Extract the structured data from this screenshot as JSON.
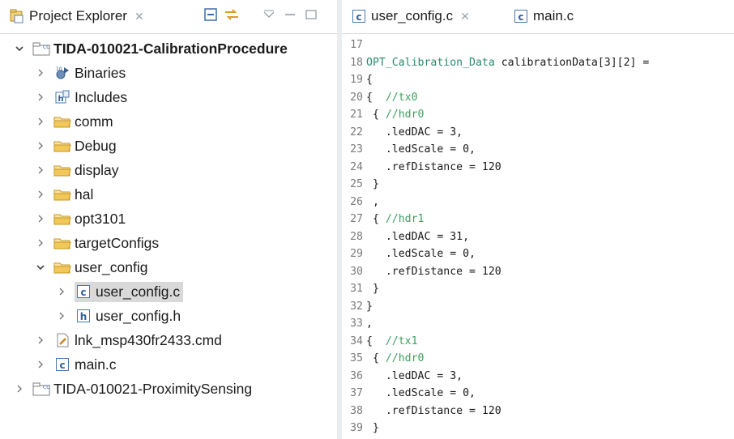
{
  "explorer": {
    "tab_label": "Project Explorer",
    "tree": [
      {
        "label": "TIDA-010021-CalibrationProcedure",
        "depth": 0,
        "expanded": true,
        "icon": "project-icon",
        "bold": true
      },
      {
        "label": "Binaries",
        "depth": 1,
        "expanded": false,
        "icon": "binaries-icon"
      },
      {
        "label": "Includes",
        "depth": 1,
        "expanded": false,
        "icon": "includes-icon"
      },
      {
        "label": "comm",
        "depth": 1,
        "expanded": false,
        "icon": "folder-icon"
      },
      {
        "label": "Debug",
        "depth": 1,
        "expanded": false,
        "icon": "folder-icon"
      },
      {
        "label": "display",
        "depth": 1,
        "expanded": false,
        "icon": "folder-icon"
      },
      {
        "label": "hal",
        "depth": 1,
        "expanded": false,
        "icon": "folder-icon"
      },
      {
        "label": "opt3101",
        "depth": 1,
        "expanded": false,
        "icon": "folder-icon"
      },
      {
        "label": "targetConfigs",
        "depth": 1,
        "expanded": false,
        "icon": "folder-icon"
      },
      {
        "label": "user_config",
        "depth": 1,
        "expanded": true,
        "icon": "folder-icon"
      },
      {
        "label": "user_config.c",
        "depth": 2,
        "expanded": false,
        "icon": "c-file-icon",
        "selected": true
      },
      {
        "label": "user_config.h",
        "depth": 2,
        "expanded": false,
        "icon": "h-file-icon"
      },
      {
        "label": "lnk_msp430fr2433.cmd",
        "depth": 1,
        "expanded": false,
        "icon": "cmd-file-icon"
      },
      {
        "label": "main.c",
        "depth": 1,
        "expanded": false,
        "icon": "c-file-icon"
      },
      {
        "label": "TIDA-010021-ProximitySensing",
        "depth": 0,
        "expanded": false,
        "icon": "project-icon"
      }
    ]
  },
  "editor": {
    "tabs": [
      {
        "label": "user_config.c",
        "active": true
      },
      {
        "label": "main.c",
        "active": false
      }
    ],
    "lines": [
      {
        "n": "17",
        "text": ""
      },
      {
        "n": "18",
        "text": "OPT_Calibration_Data calibrationData[3][2] ="
      },
      {
        "n": "19",
        "text": "{"
      },
      {
        "n": "20",
        "text": "{  //tx0"
      },
      {
        "n": "21",
        "text": " { //hdr0"
      },
      {
        "n": "22",
        "text": "   .ledDAC = 3,"
      },
      {
        "n": "23",
        "text": "   .ledScale = 0,"
      },
      {
        "n": "24",
        "text": "   .refDistance = 120"
      },
      {
        "n": "25",
        "text": " }"
      },
      {
        "n": "26",
        "text": " ,"
      },
      {
        "n": "27",
        "text": " { //hdr1"
      },
      {
        "n": "28",
        "text": "   .ledDAC = 31,"
      },
      {
        "n": "29",
        "text": "   .ledScale = 0,"
      },
      {
        "n": "30",
        "text": "   .refDistance = 120"
      },
      {
        "n": "31",
        "text": " }"
      },
      {
        "n": "32",
        "text": "}"
      },
      {
        "n": "33",
        "text": ","
      },
      {
        "n": "34",
        "text": "{  //tx1"
      },
      {
        "n": "35",
        "text": " { //hdr0"
      },
      {
        "n": "36",
        "text": "   .ledDAC = 3,"
      },
      {
        "n": "37",
        "text": "   .ledScale = 0,"
      },
      {
        "n": "38",
        "text": "   .refDistance = 120"
      },
      {
        "n": "39",
        "text": " }"
      }
    ]
  },
  "colors": {
    "selection": "#d9d9d9",
    "comment": "#3f9f5f",
    "type": "#2b8a6a",
    "folder": "#e8b84a"
  }
}
